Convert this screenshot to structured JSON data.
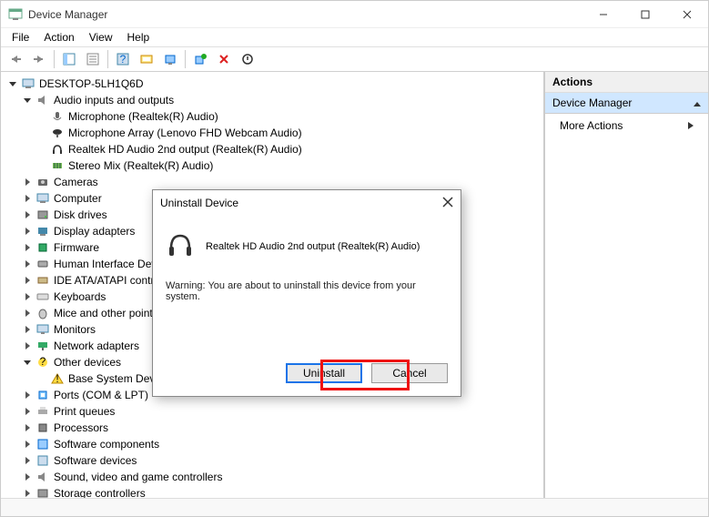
{
  "window": {
    "title": "Device Manager",
    "menu": [
      "File",
      "Action",
      "View",
      "Help"
    ]
  },
  "actions": {
    "header": "Actions",
    "section": "Device Manager",
    "more": "More Actions"
  },
  "tree": {
    "root": "DESKTOP-5LH1Q6D",
    "audio": {
      "label": "Audio inputs and outputs",
      "items": [
        "Microphone (Realtek(R) Audio)",
        "Microphone Array (Lenovo FHD Webcam Audio)",
        "Realtek HD Audio 2nd output (Realtek(R) Audio)",
        "Stereo Mix (Realtek(R) Audio)"
      ]
    },
    "categories": [
      "Cameras",
      "Computer",
      "Disk drives",
      "Display adapters",
      "Firmware",
      "Human Interface Devices",
      "IDE ATA/ATAPI controllers",
      "Keyboards",
      "Mice and other pointing devices",
      "Monitors",
      "Network adapters"
    ],
    "other": {
      "label": "Other devices",
      "items": [
        "Base System Device"
      ]
    },
    "categories2": [
      "Ports (COM & LPT)",
      "Print queues",
      "Processors",
      "Software components",
      "Software devices",
      "Sound, video and game controllers",
      "Storage controllers"
    ]
  },
  "dialog": {
    "title": "Uninstall Device",
    "device": "Realtek HD Audio 2nd output (Realtek(R) Audio)",
    "warning": "Warning: You are about to uninstall this device from your system.",
    "ok": "Uninstall",
    "cancel": "Cancel"
  }
}
